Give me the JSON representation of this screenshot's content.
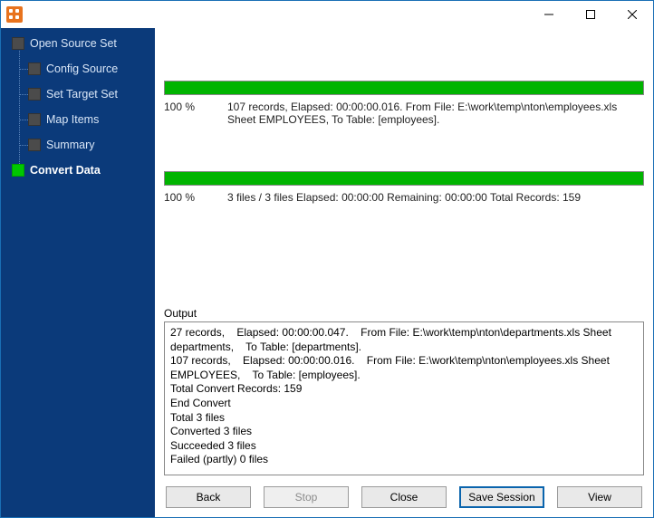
{
  "titlebar": {
    "title": ""
  },
  "sidebar": {
    "steps": [
      {
        "label": "Open Source Set",
        "level": "root"
      },
      {
        "label": "Config Source",
        "level": "child"
      },
      {
        "label": "Set Target Set",
        "level": "child"
      },
      {
        "label": "Map Items",
        "level": "child"
      },
      {
        "label": "Summary",
        "level": "child"
      },
      {
        "label": "Convert Data",
        "level": "last",
        "active": true
      }
    ]
  },
  "progress1": {
    "percent": 100,
    "percent_text": "100 %",
    "details": "107 records,    Elapsed: 00:00:00.016.    From File: E:\\work\\temp\\nton\\employees.xls Sheet EMPLOYEES,    To Table: [employees]."
  },
  "progress2": {
    "percent": 100,
    "percent_text": "100 %",
    "details": "3 files / 3 files    Elapsed: 00:00:00    Remaining: 00:00:00    Total Records: 159"
  },
  "output": {
    "label": "Output",
    "text": "27 records,    Elapsed: 00:00:00.047.    From File: E:\\work\\temp\\nton\\departments.xls Sheet departments,    To Table: [departments].\n107 records,    Elapsed: 00:00:00.016.    From File: E:\\work\\temp\\nton\\employees.xls Sheet EMPLOYEES,    To Table: [employees].\nTotal Convert Records: 159\nEnd Convert\nTotal 3 files\nConverted 3 files\nSucceeded 3 files\nFailed (partly) 0 files"
  },
  "buttons": {
    "back": "Back",
    "stop": "Stop",
    "close": "Close",
    "save_session": "Save Session",
    "view": "View"
  },
  "colors": {
    "sidebar_bg": "#0b3a7a",
    "progress_fill": "#00b400",
    "window_border": "#1a6fb5"
  }
}
